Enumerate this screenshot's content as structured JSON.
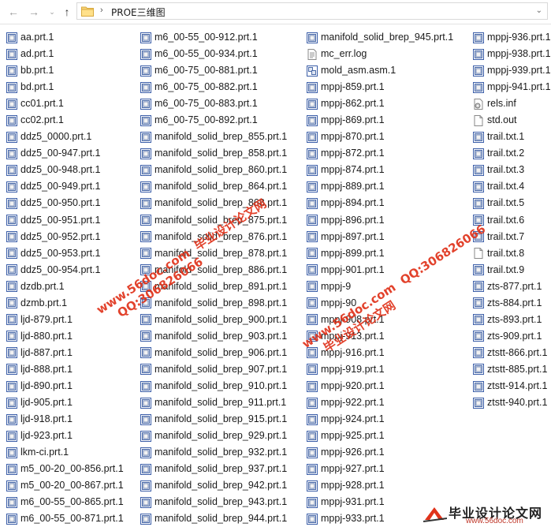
{
  "nav": {
    "breadcrumb": "PROE三维图"
  },
  "columns": [
    [
      {
        "name": "aa.prt.1",
        "icon": "part-icon"
      },
      {
        "name": "ad.prt.1",
        "icon": "part-icon"
      },
      {
        "name": "bb.prt.1",
        "icon": "part-icon"
      },
      {
        "name": "bd.prt.1",
        "icon": "part-icon"
      },
      {
        "name": "cc01.prt.1",
        "icon": "part-icon"
      },
      {
        "name": "cc02.prt.1",
        "icon": "part-icon"
      },
      {
        "name": "ddz5_0000.prt.1",
        "icon": "part-icon"
      },
      {
        "name": "ddz5_00-947.prt.1",
        "icon": "part-icon"
      },
      {
        "name": "ddz5_00-948.prt.1",
        "icon": "part-icon"
      },
      {
        "name": "ddz5_00-949.prt.1",
        "icon": "part-icon"
      },
      {
        "name": "ddz5_00-950.prt.1",
        "icon": "part-icon"
      },
      {
        "name": "ddz5_00-951.prt.1",
        "icon": "part-icon"
      },
      {
        "name": "ddz5_00-952.prt.1",
        "icon": "part-icon"
      },
      {
        "name": "ddz5_00-953.prt.1",
        "icon": "part-icon"
      },
      {
        "name": "ddz5_00-954.prt.1",
        "icon": "part-icon"
      },
      {
        "name": "dzdb.prt.1",
        "icon": "part-icon"
      },
      {
        "name": "dzmb.prt.1",
        "icon": "part-icon"
      },
      {
        "name": "ljd-879.prt.1",
        "icon": "part-icon"
      },
      {
        "name": "ljd-880.prt.1",
        "icon": "part-icon"
      },
      {
        "name": "ljd-887.prt.1",
        "icon": "part-icon"
      },
      {
        "name": "ljd-888.prt.1",
        "icon": "part-icon"
      },
      {
        "name": "ljd-890.prt.1",
        "icon": "part-icon"
      },
      {
        "name": "ljd-905.prt.1",
        "icon": "part-icon"
      },
      {
        "name": "ljd-918.prt.1",
        "icon": "part-icon"
      },
      {
        "name": "ljd-923.prt.1",
        "icon": "part-icon"
      },
      {
        "name": "lkm-ci.prt.1",
        "icon": "part-icon"
      },
      {
        "name": "m5_00-20_00-856.prt.1",
        "icon": "part-icon"
      },
      {
        "name": "m5_00-20_00-867.prt.1",
        "icon": "part-icon"
      },
      {
        "name": "m6_00-55_00-865.prt.1",
        "icon": "part-icon"
      },
      {
        "name": "m6_00-55_00-871.prt.1",
        "icon": "part-icon"
      }
    ],
    [
      {
        "name": "m6_00-55_00-912.prt.1",
        "icon": "part-icon"
      },
      {
        "name": "m6_00-55_00-934.prt.1",
        "icon": "part-icon"
      },
      {
        "name": "m6_00-75_00-881.prt.1",
        "icon": "part-icon"
      },
      {
        "name": "m6_00-75_00-882.prt.1",
        "icon": "part-icon"
      },
      {
        "name": "m6_00-75_00-883.prt.1",
        "icon": "part-icon"
      },
      {
        "name": "m6_00-75_00-892.prt.1",
        "icon": "part-icon"
      },
      {
        "name": "manifold_solid_brep_855.prt.1",
        "icon": "part-icon"
      },
      {
        "name": "manifold_solid_brep_858.prt.1",
        "icon": "part-icon"
      },
      {
        "name": "manifold_solid_brep_860.prt.1",
        "icon": "part-icon"
      },
      {
        "name": "manifold_solid_brep_864.prt.1",
        "icon": "part-icon"
      },
      {
        "name": "manifold_solid_brep_868.prt.1",
        "icon": "part-icon"
      },
      {
        "name": "manifold_solid_brep_875.prt.1",
        "icon": "part-icon"
      },
      {
        "name": "manifold_solid_brep_876.prt.1",
        "icon": "part-icon"
      },
      {
        "name": "manifold_solid_brep_878.prt.1",
        "icon": "part-icon"
      },
      {
        "name": "manifold_solid_brep_886.prt.1",
        "icon": "part-icon"
      },
      {
        "name": "manifold_solid_brep_891.prt.1",
        "icon": "part-icon"
      },
      {
        "name": "manifold_solid_brep_898.prt.1",
        "icon": "part-icon"
      },
      {
        "name": "manifold_solid_brep_900.prt.1",
        "icon": "part-icon"
      },
      {
        "name": "manifold_solid_brep_903.prt.1",
        "icon": "part-icon"
      },
      {
        "name": "manifold_solid_brep_906.prt.1",
        "icon": "part-icon"
      },
      {
        "name": "manifold_solid_brep_907.prt.1",
        "icon": "part-icon"
      },
      {
        "name": "manifold_solid_brep_910.prt.1",
        "icon": "part-icon"
      },
      {
        "name": "manifold_solid_brep_911.prt.1",
        "icon": "part-icon"
      },
      {
        "name": "manifold_solid_brep_915.prt.1",
        "icon": "part-icon"
      },
      {
        "name": "manifold_solid_brep_929.prt.1",
        "icon": "part-icon"
      },
      {
        "name": "manifold_solid_brep_932.prt.1",
        "icon": "part-icon"
      },
      {
        "name": "manifold_solid_brep_937.prt.1",
        "icon": "part-icon"
      },
      {
        "name": "manifold_solid_brep_942.prt.1",
        "icon": "part-icon"
      },
      {
        "name": "manifold_solid_brep_943.prt.1",
        "icon": "part-icon"
      },
      {
        "name": "manifold_solid_brep_944.prt.1",
        "icon": "part-icon"
      }
    ],
    [
      {
        "name": "manifold_solid_brep_945.prt.1",
        "icon": "part-icon"
      },
      {
        "name": "mc_err.log",
        "icon": "log-file-icon"
      },
      {
        "name": "mold_asm.asm.1",
        "icon": "assembly-icon"
      },
      {
        "name": "mppj-859.prt.1",
        "icon": "part-icon"
      },
      {
        "name": "mppj-862.prt.1",
        "icon": "part-icon"
      },
      {
        "name": "mppj-869.prt.1",
        "icon": "part-icon"
      },
      {
        "name": "mppj-870.prt.1",
        "icon": "part-icon"
      },
      {
        "name": "mppj-872.prt.1",
        "icon": "part-icon"
      },
      {
        "name": "mppj-874.prt.1",
        "icon": "part-icon"
      },
      {
        "name": "mppj-889.prt.1",
        "icon": "part-icon"
      },
      {
        "name": "mppj-894.prt.1",
        "icon": "part-icon"
      },
      {
        "name": "mppj-896.prt.1",
        "icon": "part-icon"
      },
      {
        "name": "mppj-897.prt.1",
        "icon": "part-icon"
      },
      {
        "name": "mppj-899.prt.1",
        "icon": "part-icon"
      },
      {
        "name": "mppj-901.prt.1",
        "icon": "part-icon"
      },
      {
        "name": "mppj-9",
        "icon": "part-icon"
      },
      {
        "name": "mppj-90",
        "icon": "part-icon"
      },
      {
        "name": "mppj-908.prt.1",
        "icon": "part-icon"
      },
      {
        "name": "mppj-913.prt.1",
        "icon": "part-icon"
      },
      {
        "name": "mppj-916.prt.1",
        "icon": "part-icon"
      },
      {
        "name": "mppj-919.prt.1",
        "icon": "part-icon"
      },
      {
        "name": "mppj-920.prt.1",
        "icon": "part-icon"
      },
      {
        "name": "mppj-922.prt.1",
        "icon": "part-icon"
      },
      {
        "name": "mppj-924.prt.1",
        "icon": "part-icon"
      },
      {
        "name": "mppj-925.prt.1",
        "icon": "part-icon"
      },
      {
        "name": "mppj-926.prt.1",
        "icon": "part-icon"
      },
      {
        "name": "mppj-927.prt.1",
        "icon": "part-icon"
      },
      {
        "name": "mppj-928.prt.1",
        "icon": "part-icon"
      },
      {
        "name": "mppj-931.prt.1",
        "icon": "part-icon"
      },
      {
        "name": "mppj-933.prt.1",
        "icon": "part-icon"
      }
    ],
    [
      {
        "name": "mppj-936.prt.1",
        "icon": "part-icon"
      },
      {
        "name": "mppj-938.prt.1",
        "icon": "part-icon"
      },
      {
        "name": "mppj-939.prt.1",
        "icon": "part-icon"
      },
      {
        "name": "mppj-941.prt.1",
        "icon": "part-icon"
      },
      {
        "name": "rels.inf",
        "icon": "settings-file-icon"
      },
      {
        "name": "std.out",
        "icon": "blank-file-icon"
      },
      {
        "name": "trail.txt.1",
        "icon": "part-icon"
      },
      {
        "name": "trail.txt.2",
        "icon": "part-icon"
      },
      {
        "name": "trail.txt.3",
        "icon": "part-icon"
      },
      {
        "name": "trail.txt.4",
        "icon": "part-icon"
      },
      {
        "name": "trail.txt.5",
        "icon": "part-icon"
      },
      {
        "name": "trail.txt.6",
        "icon": "part-icon"
      },
      {
        "name": "trail.txt.7",
        "icon": "part-icon"
      },
      {
        "name": "trail.txt.8",
        "icon": "blank-file-icon"
      },
      {
        "name": "trail.txt.9",
        "icon": "part-icon"
      },
      {
        "name": "zts-877.prt.1",
        "icon": "part-icon"
      },
      {
        "name": "zts-884.prt.1",
        "icon": "part-icon"
      },
      {
        "name": "zts-893.prt.1",
        "icon": "part-icon"
      },
      {
        "name": "zts-909.prt.1",
        "icon": "part-icon"
      },
      {
        "name": "ztstt-866.prt.1",
        "icon": "part-icon"
      },
      {
        "name": "ztstt-885.prt.1",
        "icon": "part-icon"
      },
      {
        "name": "ztstt-914.prt.1",
        "icon": "part-icon"
      },
      {
        "name": "ztstt-940.prt.1",
        "icon": "part-icon"
      }
    ]
  ],
  "watermark": {
    "line1": "毕业设计论文网",
    "url": "www.56doc.com",
    "qq": "QQ:306826066"
  },
  "logo": {
    "title": "毕业设计论文网",
    "url": "www.56doc.com"
  },
  "colors": {
    "watermark": "#e0331b",
    "part_icon_frame": "#3b5ea8"
  }
}
